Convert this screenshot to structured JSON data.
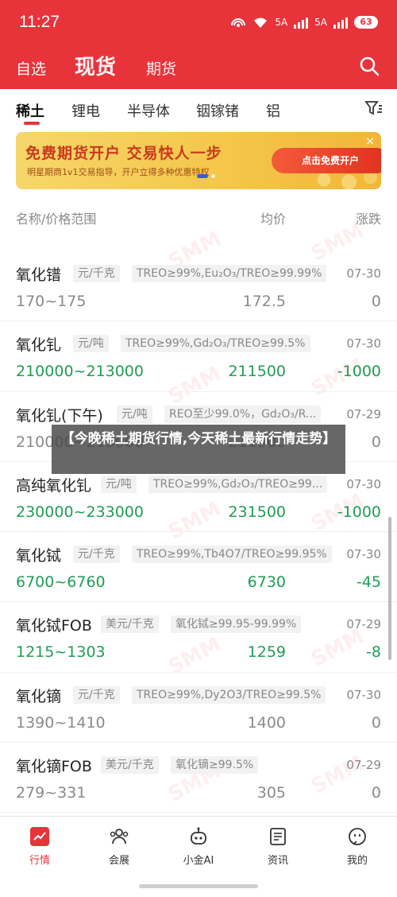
{
  "status_bar": {
    "time": "11:27",
    "network1": "5A",
    "network2": "5A",
    "battery": "63"
  },
  "header": {
    "tabs": [
      "自选",
      "现货",
      "期货"
    ],
    "active_tab": "现货",
    "accent": "#e8333b"
  },
  "categories": {
    "items": [
      "稀土",
      "锂电",
      "半导体",
      "铟镓锗",
      "铝"
    ],
    "active": "稀土"
  },
  "banner": {
    "headline": "免费期货开户  交易快人一步",
    "subline": "明星期商1v1交易指导，开户立得多种优惠特权",
    "cta": "点击免费开户",
    "close": "×"
  },
  "list_header": {
    "name_col": "名称/价格范围",
    "avg_col": "均价",
    "change_col": "涨跌"
  },
  "rows": [
    {
      "name": "氧化镨",
      "unit": "元/千克",
      "spec": "TREO≥99%,Eu₂O₃/TREO≥99.99%",
      "date": "07-30",
      "range": "170~175",
      "avg": "172.5",
      "change": "0",
      "trend": "flat"
    },
    {
      "name": "氧化钆",
      "unit": "元/吨",
      "spec": "TREO≥99%,Gd₂O₃/TREO≥99.5%",
      "date": "07-30",
      "range": "210000~213000",
      "avg": "211500",
      "change": "-1000",
      "trend": "down"
    },
    {
      "name": "氧化钆(下午)",
      "unit": "元/吨",
      "spec": "REO至少99.0%，Gd₂O₃/R...",
      "date": "07-29",
      "range": "210000~213000",
      "avg": "211500",
      "change": "0",
      "trend": "flat"
    },
    {
      "name": "高纯氧化钆",
      "unit": "元/吨",
      "spec": "TREO≥99%,Gd₂O₃/TREO≥99...",
      "date": "07-30",
      "range": "230000~233000",
      "avg": "231500",
      "change": "-1000",
      "trend": "down"
    },
    {
      "name": "氧化铽",
      "unit": "元/千克",
      "spec": "TREO≥99%,Tb4O7/TREO≥99.95%",
      "date": "07-30",
      "range": "6700~6760",
      "avg": "6730",
      "change": "-45",
      "trend": "down"
    },
    {
      "name": "氧化铽FOB",
      "unit": "美元/千克",
      "spec": "氧化铽≥99.95-99.99%",
      "date": "07-29",
      "range": "1215~1303",
      "avg": "1259",
      "change": "-8",
      "trend": "down"
    },
    {
      "name": "氧化镝",
      "unit": "元/千克",
      "spec": "TREO≥99%,Dy2O3/TREO≥99.5%",
      "date": "07-30",
      "range": "1390~1410",
      "avg": "1400",
      "change": "0",
      "trend": "flat"
    },
    {
      "name": "氧化镝FOB",
      "unit": "美元/千克",
      "spec": "氧化镝≥99.5%",
      "date": "07-29",
      "range": "279~331",
      "avg": "305",
      "change": "0",
      "trend": "flat"
    }
  ],
  "overlay": {
    "text": "【今晚稀土期货行情,今天稀土最新行情走势】"
  },
  "watermark": "SMM",
  "bottom_nav": {
    "items": [
      "行情",
      "会展",
      "小金AI",
      "资讯",
      "我的"
    ],
    "active": "行情"
  },
  "colors": {
    "down": "#1f9d55",
    "flat": "#8a8a8a"
  }
}
